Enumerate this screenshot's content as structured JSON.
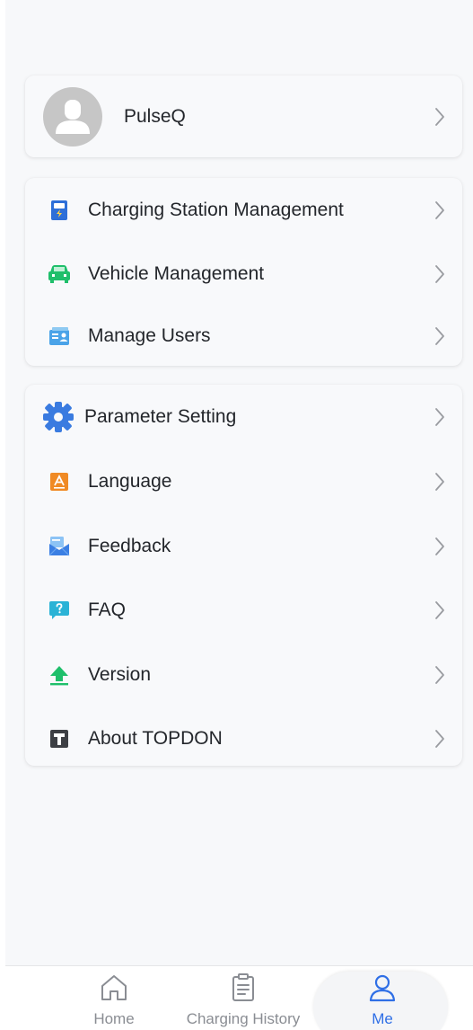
{
  "profile": {
    "name": "PulseQ"
  },
  "group1": [
    {
      "label": "Charging Station Management",
      "icon": "charging-station-icon"
    },
    {
      "label": "Vehicle Management",
      "icon": "car-icon"
    },
    {
      "label": "Manage Users",
      "icon": "users-icon"
    }
  ],
  "group2": [
    {
      "label": "Parameter Setting",
      "icon": "gear-icon"
    },
    {
      "label": "Language",
      "icon": "language-icon"
    },
    {
      "label": "Feedback",
      "icon": "envelope-icon"
    },
    {
      "label": "FAQ",
      "icon": "question-icon"
    },
    {
      "label": "Version",
      "icon": "upload-arrow-icon"
    },
    {
      "label": "About TOPDON",
      "icon": "topdon-logo-icon"
    }
  ],
  "tabbar": {
    "home": "Home",
    "history": "Charging History",
    "me": "Me",
    "active": "me"
  },
  "colors": {
    "accent": "#2f6fe6",
    "green": "#1fbf6b",
    "orange": "#f08a24"
  }
}
